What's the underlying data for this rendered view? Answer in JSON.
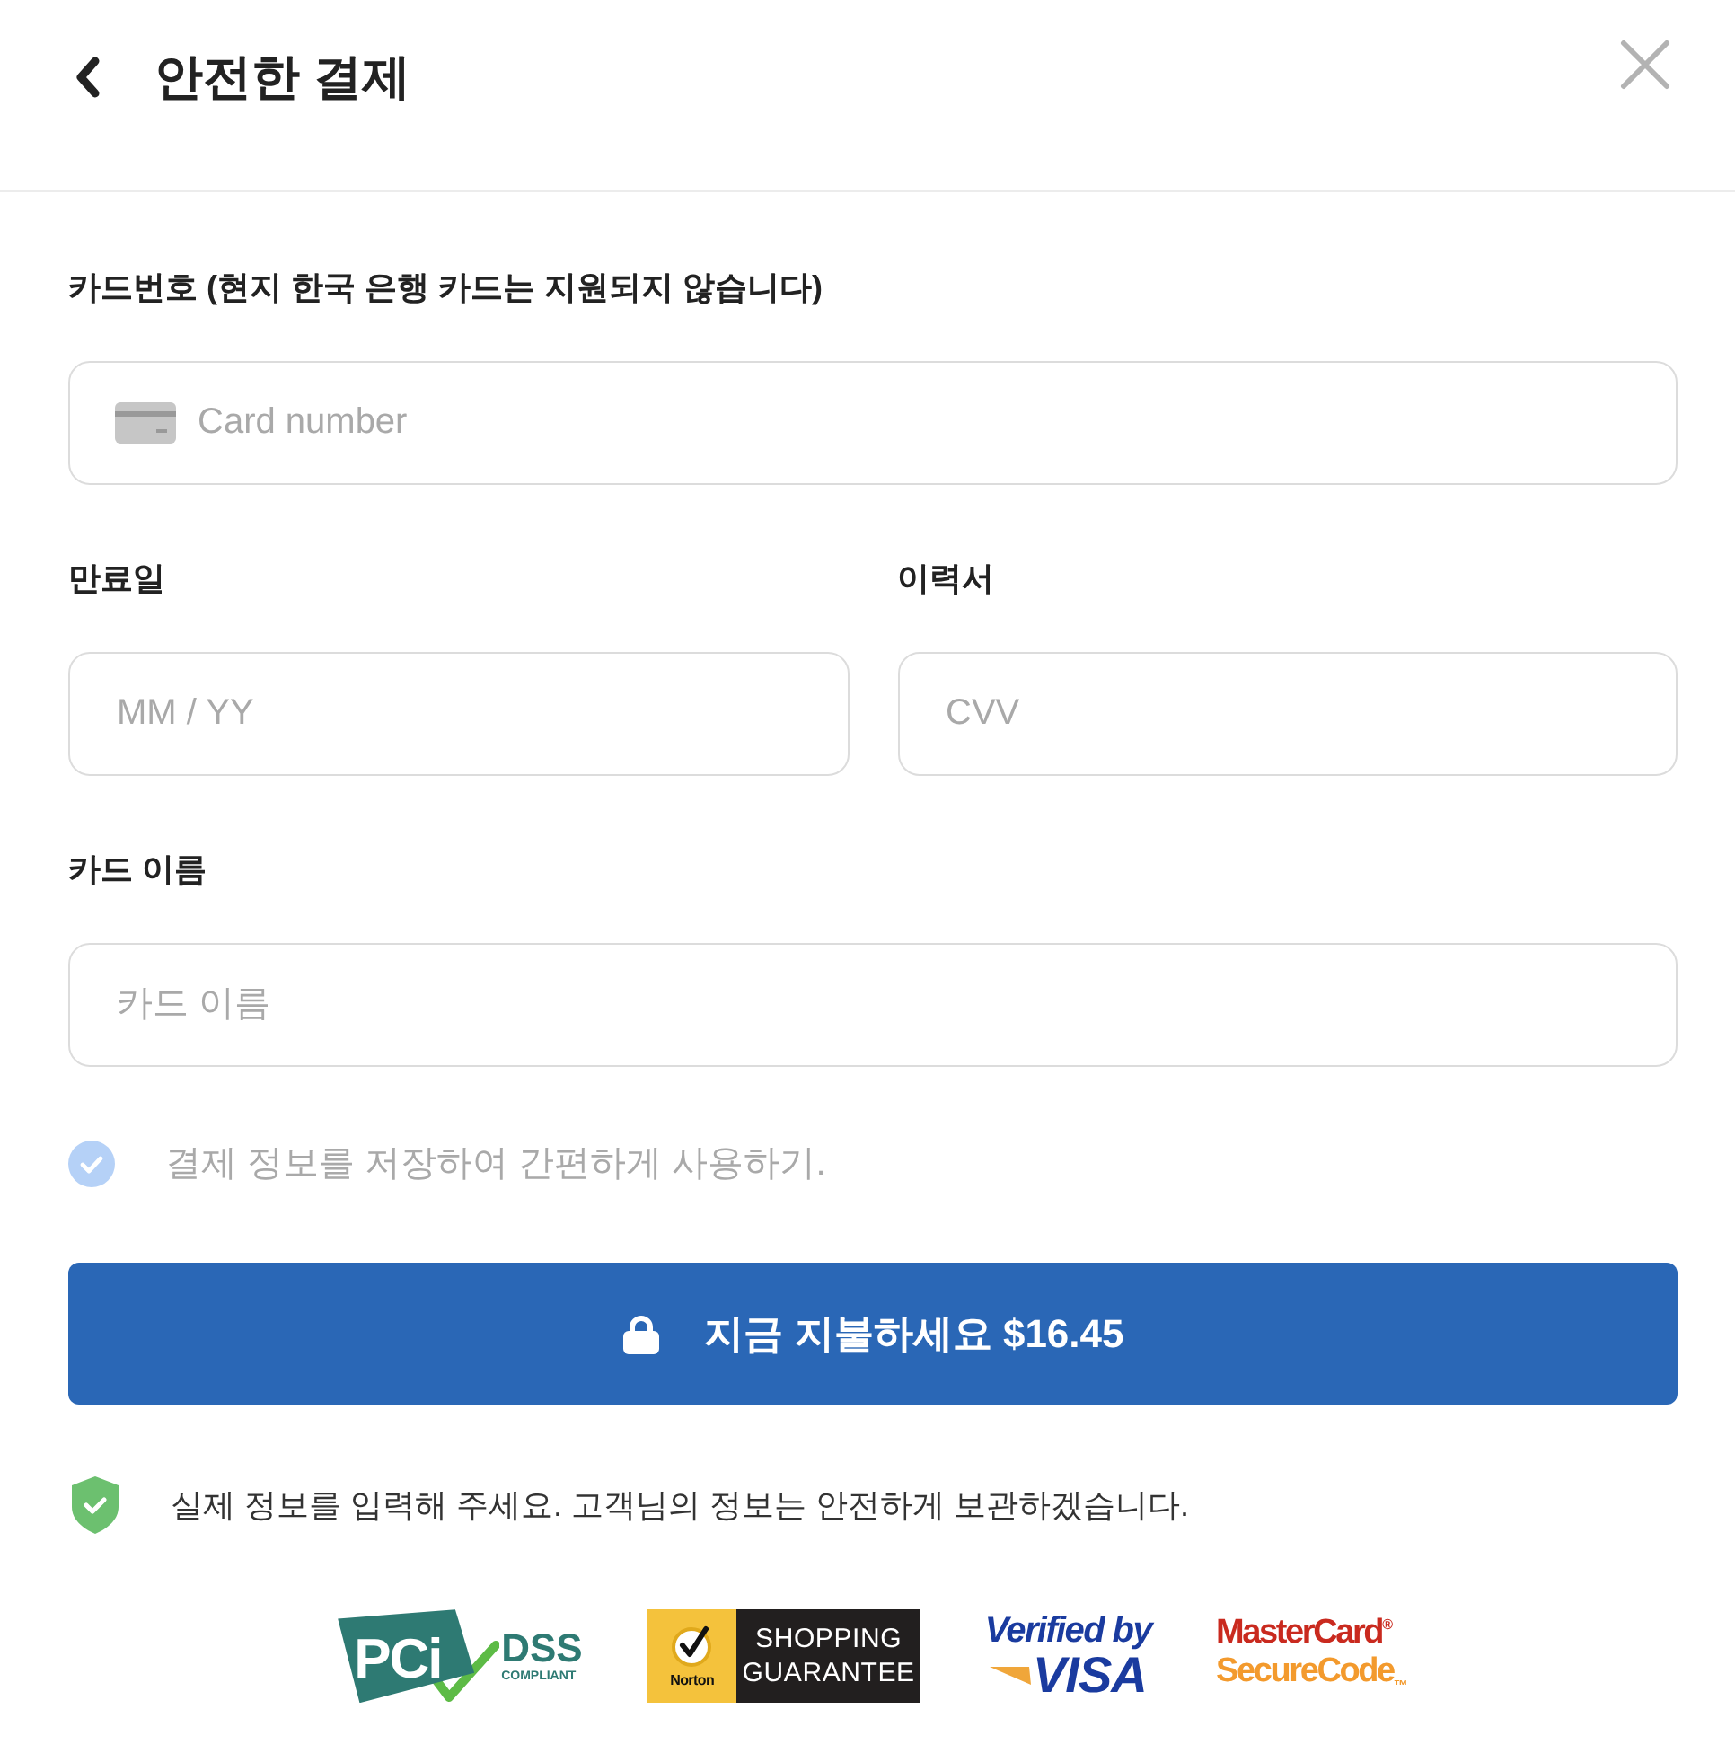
{
  "header": {
    "title": "안전한 결제"
  },
  "form": {
    "rows": [
      {
        "fields": [
          {
            "kind": "card",
            "label": "카드번호 (현지 한국 은행 카드는 지원되지 않습니다)",
            "placeholder": "Card number"
          }
        ]
      },
      {
        "fields": [
          {
            "kind": "text",
            "label": "만료일",
            "placeholder": "MM / YY"
          },
          {
            "kind": "text",
            "label": "이력서",
            "placeholder": "CVV"
          }
        ]
      },
      {
        "fields": [
          {
            "kind": "text",
            "label": "카드 이름",
            "placeholder": "카드 이름"
          }
        ]
      }
    ]
  },
  "save_option": {
    "label": "결제 정보를 저장하여 간편하게 사용하기.",
    "checked": true
  },
  "pay_button": {
    "label": "지금 지불하세요 $16.45"
  },
  "security_note": "실제 정보를 입력해 주세요. 고객님의 정보는 안전하게 보관하겠습니다.",
  "badges": [
    {
      "kind": "pci",
      "mark": "PCi",
      "title": "DSS",
      "subtitle": "COMPLIANT"
    },
    {
      "kind": "norton",
      "mark": "Norton",
      "title": "SHOPPING",
      "subtitle": "GUARANTEE"
    },
    {
      "kind": "visa",
      "title": "Verified by",
      "subtitle": "VISA"
    },
    {
      "kind": "mastercard",
      "title": "MasterCard$^{®}$",
      "subtitle": "SecureCode$_{™}$"
    }
  ]
}
